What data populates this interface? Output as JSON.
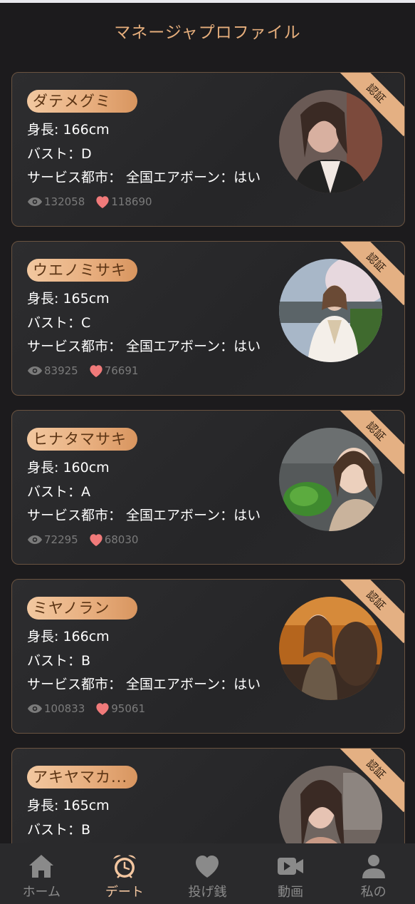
{
  "header": {
    "title": "マネージャプロファイル"
  },
  "profiles": [
    {
      "name": "ダテメグミ",
      "height": "身長: 166cm",
      "bust": "バスト：D",
      "service": "サービス都市：  全国エアボーン：はい",
      "views": "132058",
      "likes": "118690",
      "ribbon": "認証",
      "photo_colors": [
        "#6a5a55",
        "#caa596"
      ]
    },
    {
      "name": "ウエノミサキ",
      "height": "身長: 165cm",
      "bust": "バスト：C",
      "service": "サービス都市：  全国エアボーン：はい",
      "views": "83925",
      "likes": "76691",
      "ribbon": "認証",
      "photo_colors": [
        "#8aa0b8",
        "#e6d7cf"
      ]
    },
    {
      "name": "ヒナタマサキ",
      "height": "身長: 160cm",
      "bust": "バスト：A",
      "service": "サービス都市：  全国エアボーン：はい",
      "views": "72295",
      "likes": "68030",
      "ribbon": "認証",
      "photo_colors": [
        "#5a5f60",
        "#e8c9b4"
      ]
    },
    {
      "name": "ミヤノラン",
      "height": "身長: 166cm",
      "bust": "バスト：B",
      "service": "サービス都市：  全国エアボーン：はい",
      "views": "100833",
      "likes": "95061",
      "ribbon": "認証",
      "photo_colors": [
        "#b3641d",
        "#4d3a2e"
      ]
    },
    {
      "name": "アキヤマカ...",
      "height": "身長: 165cm",
      "bust": "バスト：B",
      "service": "",
      "views": "",
      "likes": "",
      "ribbon": "認証",
      "photo_colors": [
        "#6f6560",
        "#d7b9a9"
      ]
    }
  ],
  "tabbar": {
    "items": [
      {
        "label": "ホーム",
        "icon": "home-icon"
      },
      {
        "label": "デート",
        "icon": "alarm-clock-icon"
      },
      {
        "label": "投げ銭",
        "icon": "heart-icon"
      },
      {
        "label": "動画",
        "icon": "video-camera-icon"
      },
      {
        "label": "私の",
        "icon": "user-icon"
      }
    ]
  },
  "colors": {
    "accent": "#e6ae7c",
    "background": "#1c1b1d",
    "card_border": "#6a5340",
    "like": "#f07a7a",
    "muted": "#7b7b7b"
  }
}
